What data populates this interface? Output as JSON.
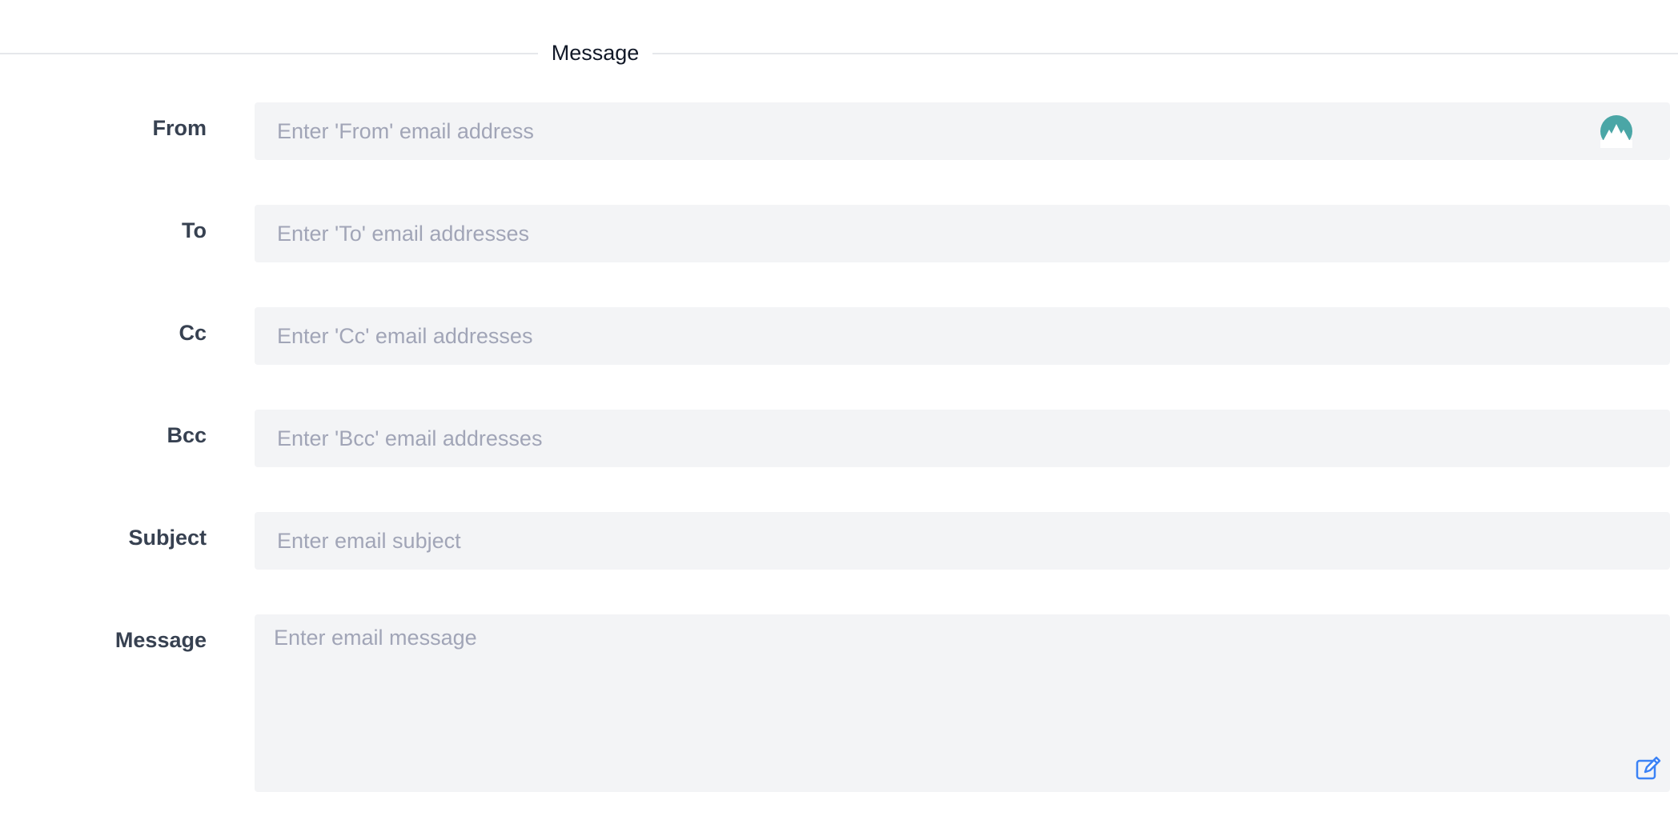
{
  "section": {
    "title": "Message"
  },
  "fields": {
    "from": {
      "label": "From",
      "placeholder": "Enter 'From' email address",
      "value": ""
    },
    "to": {
      "label": "To",
      "placeholder": "Enter 'To' email addresses",
      "value": ""
    },
    "cc": {
      "label": "Cc",
      "placeholder": "Enter 'Cc' email addresses",
      "value": ""
    },
    "bcc": {
      "label": "Bcc",
      "placeholder": "Enter 'Bcc' email addresses",
      "value": ""
    },
    "subject": {
      "label": "Subject",
      "placeholder": "Enter email subject",
      "value": ""
    },
    "message": {
      "label": "Message",
      "placeholder": "Enter email message",
      "value": ""
    }
  },
  "icons": {
    "from_field": "mountain-avatar-icon",
    "message_field": "edit-icon"
  },
  "colors": {
    "avatar_teal": "#4aa6a6",
    "edit_blue": "#3b82f6",
    "field_bg": "#f3f4f6",
    "divider": "#e5e7eb"
  }
}
